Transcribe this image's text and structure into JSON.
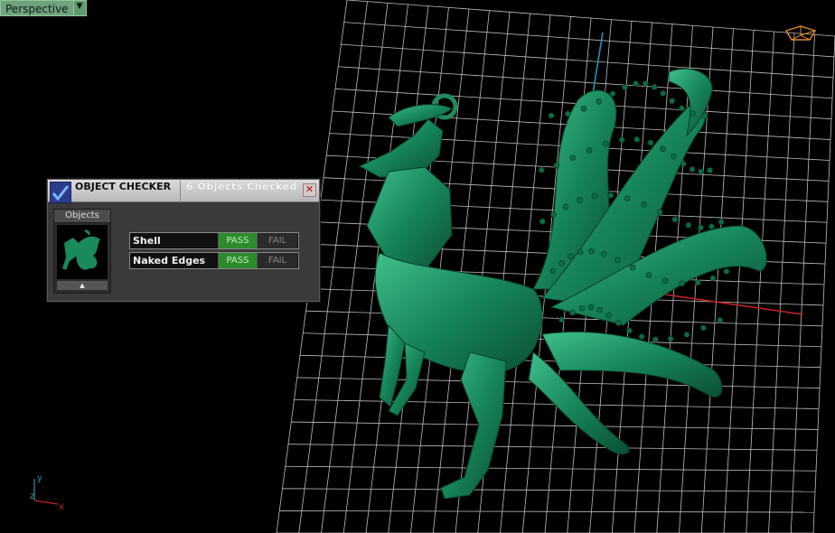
{
  "viewport": {
    "label": "Perspective",
    "dropdown_arrow": "▼"
  },
  "checker": {
    "title": "OBJECT CHECKER",
    "status": "6  Objects Checked",
    "close_glyph": "✕",
    "objects_label": "Objects",
    "scroll_glyph": "▲",
    "rows": [
      {
        "name": "Shell",
        "pass": "PASS",
        "fail": "FAIL"
      },
      {
        "name": "Naked Edges",
        "pass": "PASS",
        "fail": "FAIL"
      }
    ]
  },
  "axis": {
    "y": "y",
    "z": "z",
    "x": "x"
  },
  "colors": {
    "grid": "#bdbdbd",
    "model": "#1f8a5e",
    "model_dark": "#0c5a3a",
    "x_axis": "#c42323",
    "y_axis": "#2f8fb8",
    "pass": "#2e8a2e"
  }
}
